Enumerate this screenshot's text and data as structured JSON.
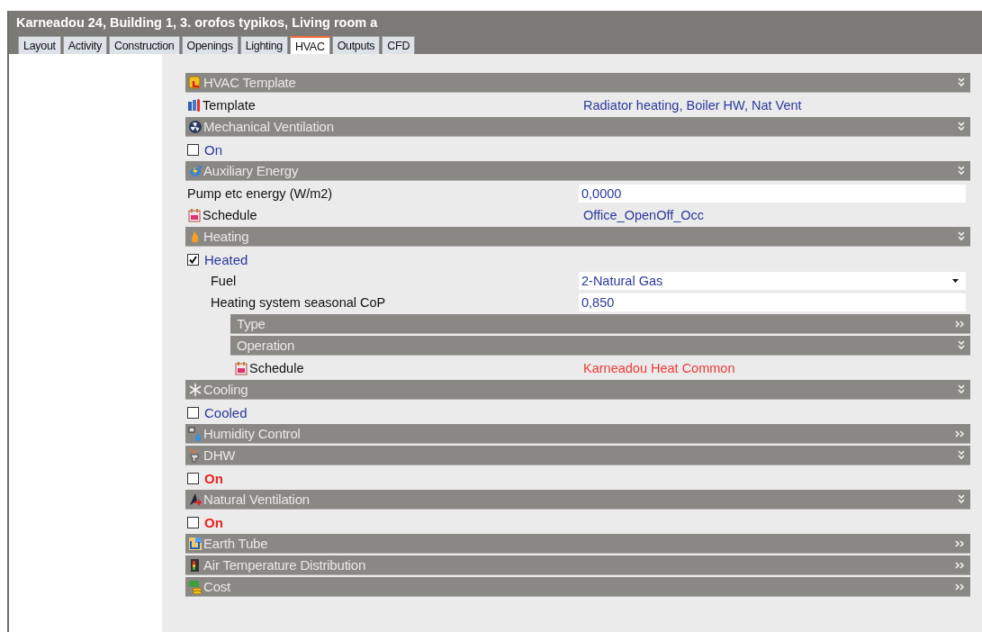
{
  "window": {
    "title": "Karneadou 24, Building 1, 3. orofos typikos, Living room a"
  },
  "tabs": [
    {
      "label": "Layout",
      "selected": false
    },
    {
      "label": "Activity",
      "selected": false
    },
    {
      "label": "Construction",
      "selected": false
    },
    {
      "label": "Openings",
      "selected": false
    },
    {
      "label": "Lighting",
      "selected": false
    },
    {
      "label": "HVAC",
      "selected": true
    },
    {
      "label": "Outputs",
      "selected": false
    },
    {
      "label": "CFD",
      "selected": false
    }
  ],
  "sections": [
    {
      "title": "HVAC Template",
      "expanded": true,
      "children": [
        {
          "kind": "template",
          "label": "Template",
          "value": "Radiator heating, Boiler HW, Nat Vent",
          "color": "#2b3a9c"
        }
      ]
    },
    {
      "title": "Mechanical Ventilation",
      "expanded": true,
      "children": [
        {
          "kind": "checkbox",
          "label": "On",
          "checked": false,
          "bold": false,
          "color": "#2b3a9c"
        }
      ]
    },
    {
      "title": "Auxiliary Energy",
      "expanded": true,
      "children": [
        {
          "kind": "input",
          "label": "Pump etc energy (W/m2)",
          "value": "0,0000"
        },
        {
          "kind": "schedule",
          "label": "Schedule",
          "value": "Office_OpenOff_Occ",
          "color": "#2b3a9c"
        }
      ]
    },
    {
      "title": "Heating",
      "expanded": true,
      "children": [
        {
          "kind": "checkbox",
          "label": "Heated",
          "checked": true,
          "bold": false,
          "color": "#2b3a9c",
          "children": [
            {
              "kind": "select",
              "label": "Fuel",
              "value": "2-Natural Gas"
            },
            {
              "kind": "input",
              "label": "Heating system seasonal CoP",
              "value": "0,850"
            },
            {
              "kind": "section",
              "title": "Type",
              "expanded": false
            },
            {
              "kind": "section",
              "title": "Operation",
              "expanded": true,
              "children": [
                {
                  "kind": "schedule",
                  "label": "Schedule",
                  "value": "Karneadou Heat Common",
                  "color": "#ee3a3a"
                }
              ]
            }
          ]
        }
      ]
    },
    {
      "title": "Cooling",
      "expanded": true,
      "children": [
        {
          "kind": "checkbox",
          "label": "Cooled",
          "checked": false,
          "bold": false,
          "color": "#2b3a9c"
        }
      ]
    },
    {
      "title": "Humidity Control",
      "expanded": false
    },
    {
      "title": "DHW",
      "expanded": true,
      "children": [
        {
          "kind": "checkbox",
          "label": "On",
          "checked": false,
          "bold": true,
          "color": "#ee2222"
        }
      ]
    },
    {
      "title": "Natural Ventilation",
      "expanded": true,
      "children": [
        {
          "kind": "checkbox",
          "label": "On",
          "checked": false,
          "bold": true,
          "color": "#ee2222"
        }
      ]
    },
    {
      "title": "Earth Tube",
      "expanded": false
    },
    {
      "title": "Air Temperature Distribution",
      "expanded": false
    },
    {
      "title": "Cost",
      "expanded": false
    }
  ]
}
